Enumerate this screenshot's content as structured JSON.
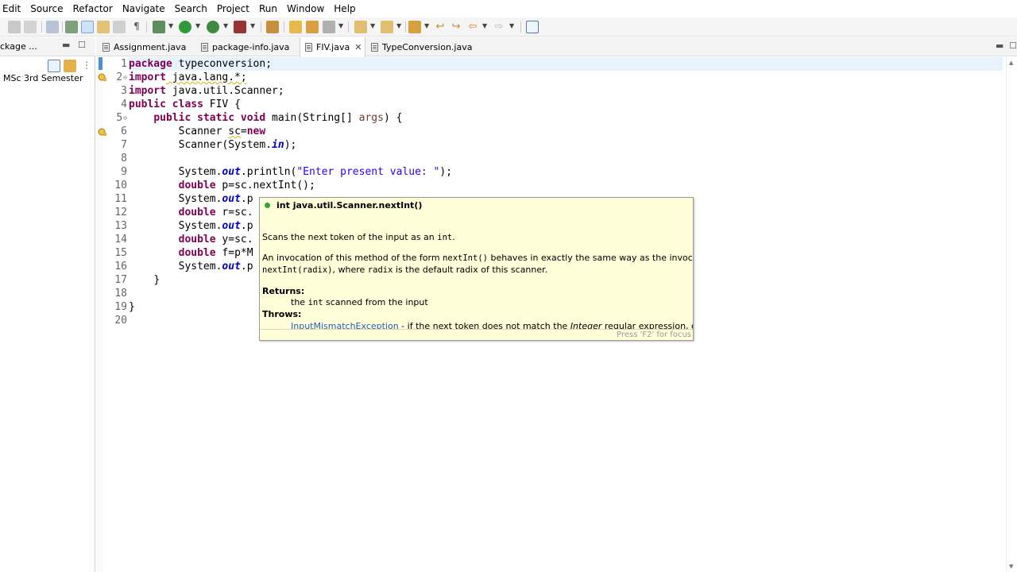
{
  "menu": [
    "Edit",
    "Source",
    "Refactor",
    "Navigate",
    "Search",
    "Project",
    "Run",
    "Window",
    "Help"
  ],
  "left_panel": {
    "tab_label": "ckage ...",
    "tree_item": "MSc 3rd Semester"
  },
  "editor": {
    "tabs": [
      {
        "label": "Assignment.java",
        "active": false
      },
      {
        "label": "package-info.java",
        "active": false
      },
      {
        "label": "FIV.java",
        "active": true,
        "close": "✕"
      },
      {
        "label": "TypeConversion.java",
        "active": false
      }
    ],
    "line_numbers": [
      "1",
      "2",
      "3",
      "4",
      "5",
      "6",
      "7",
      "8",
      "9",
      "10",
      "11",
      "12",
      "13",
      "14",
      "15",
      "16",
      "17",
      "18",
      "19",
      "20"
    ],
    "code": {
      "l1_kw": "package",
      "l1_rest": " typeconversion;",
      "l2_kw": "import",
      "l2_rest": " java.lang.*;",
      "l3_kw": "import",
      "l3_rest": " java.util.Scanner;",
      "l4_kw1": "public",
      "l4_kw2": "class",
      "l4_rest": " FIV {",
      "l5_kw1": "public",
      "l5_kw2": "static",
      "l5_kw3": "void",
      "l5_mid": " main(String[] ",
      "l5_par": "args",
      "l5_end": ") {",
      "l6_a": "Scanner ",
      "l6_b": "sc",
      "l6_c": "=",
      "l6_kw": "new",
      "l7_a": "Scanner(System.",
      "l7_fld": "in",
      "l7_end": ");",
      "l9_a": "System.",
      "l9_fld": "out",
      "l9_b": ".println(",
      "l9_str": "\"Enter present value: \"",
      "l9_end": ");",
      "l10_kw": "double",
      "l10_rest": " p=sc.nextInt();",
      "l11_a": "System.",
      "l11_fld": "out",
      "l11_b": ".p",
      "l12_kw": "double",
      "l12_rest": " r=sc.",
      "l13_a": "System.",
      "l13_fld": "out",
      "l13_b": ".p",
      "l14_kw": "double",
      "l14_rest": " y=sc.",
      "l15_kw": "double",
      "l15_rest": " f=p*M",
      "l16_a": "System.",
      "l16_fld": "out",
      "l16_b": ".p",
      "l17": "}",
      "l19": "}"
    }
  },
  "tooltip": {
    "signature": "int java.util.Scanner.nextInt()",
    "summary_a": "Scans the next token of the input as an ",
    "summary_code": "int",
    "summary_b": ".",
    "desc1_a": "An invocation of this method of the form ",
    "desc1_code": "nextInt()",
    "desc1_b": " behaves in exactly the same way as the invocation",
    "desc2_code1": "nextInt(radix)",
    "desc2_a": ", where ",
    "desc2_code2": "radix",
    "desc2_b": " is the default radix of this scanner.",
    "returns_label": "Returns:",
    "returns_a": "the ",
    "returns_code": "int",
    "returns_b": " scanned from the input",
    "throws_label": "Throws:",
    "throws_link": "InputMismatchException",
    "throws_a": " - if the next token does not match the ",
    "throws_em": "Integer",
    "throws_b": " regular expression, or is out of",
    "focus_hint": "Press 'F2' for focus"
  }
}
